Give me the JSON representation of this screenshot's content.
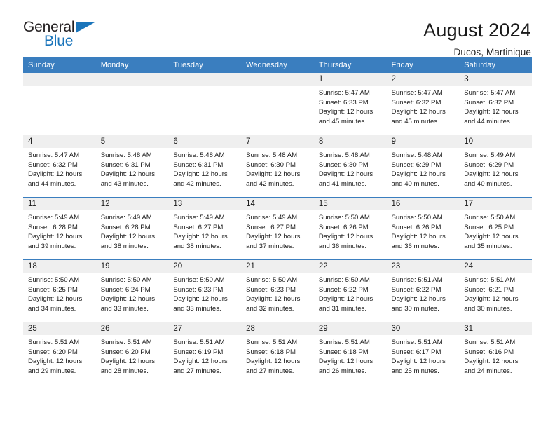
{
  "brand": {
    "name_part1": "General",
    "name_part2": "Blue",
    "triangle_color": "#1b75bb"
  },
  "header": {
    "title": "August 2024",
    "subtitle": "Ducos, Martinique"
  },
  "colors": {
    "header_blue": "#3a7ebf",
    "daynum_band": "#efefef",
    "text": "#1a1a1a"
  },
  "weekday_headers": [
    "Sunday",
    "Monday",
    "Tuesday",
    "Wednesday",
    "Thursday",
    "Friday",
    "Saturday"
  ],
  "weeks": [
    [
      {
        "day": "",
        "lines": []
      },
      {
        "day": "",
        "lines": []
      },
      {
        "day": "",
        "lines": []
      },
      {
        "day": "",
        "lines": []
      },
      {
        "day": "1",
        "lines": [
          "Sunrise: 5:47 AM",
          "Sunset: 6:33 PM",
          "Daylight: 12 hours",
          "and 45 minutes."
        ]
      },
      {
        "day": "2",
        "lines": [
          "Sunrise: 5:47 AM",
          "Sunset: 6:32 PM",
          "Daylight: 12 hours",
          "and 45 minutes."
        ]
      },
      {
        "day": "3",
        "lines": [
          "Sunrise: 5:47 AM",
          "Sunset: 6:32 PM",
          "Daylight: 12 hours",
          "and 44 minutes."
        ]
      }
    ],
    [
      {
        "day": "4",
        "lines": [
          "Sunrise: 5:47 AM",
          "Sunset: 6:32 PM",
          "Daylight: 12 hours",
          "and 44 minutes."
        ]
      },
      {
        "day": "5",
        "lines": [
          "Sunrise: 5:48 AM",
          "Sunset: 6:31 PM",
          "Daylight: 12 hours",
          "and 43 minutes."
        ]
      },
      {
        "day": "6",
        "lines": [
          "Sunrise: 5:48 AM",
          "Sunset: 6:31 PM",
          "Daylight: 12 hours",
          "and 42 minutes."
        ]
      },
      {
        "day": "7",
        "lines": [
          "Sunrise: 5:48 AM",
          "Sunset: 6:30 PM",
          "Daylight: 12 hours",
          "and 42 minutes."
        ]
      },
      {
        "day": "8",
        "lines": [
          "Sunrise: 5:48 AM",
          "Sunset: 6:30 PM",
          "Daylight: 12 hours",
          "and 41 minutes."
        ]
      },
      {
        "day": "9",
        "lines": [
          "Sunrise: 5:48 AM",
          "Sunset: 6:29 PM",
          "Daylight: 12 hours",
          "and 40 minutes."
        ]
      },
      {
        "day": "10",
        "lines": [
          "Sunrise: 5:49 AM",
          "Sunset: 6:29 PM",
          "Daylight: 12 hours",
          "and 40 minutes."
        ]
      }
    ],
    [
      {
        "day": "11",
        "lines": [
          "Sunrise: 5:49 AM",
          "Sunset: 6:28 PM",
          "Daylight: 12 hours",
          "and 39 minutes."
        ]
      },
      {
        "day": "12",
        "lines": [
          "Sunrise: 5:49 AM",
          "Sunset: 6:28 PM",
          "Daylight: 12 hours",
          "and 38 minutes."
        ]
      },
      {
        "day": "13",
        "lines": [
          "Sunrise: 5:49 AM",
          "Sunset: 6:27 PM",
          "Daylight: 12 hours",
          "and 38 minutes."
        ]
      },
      {
        "day": "14",
        "lines": [
          "Sunrise: 5:49 AM",
          "Sunset: 6:27 PM",
          "Daylight: 12 hours",
          "and 37 minutes."
        ]
      },
      {
        "day": "15",
        "lines": [
          "Sunrise: 5:50 AM",
          "Sunset: 6:26 PM",
          "Daylight: 12 hours",
          "and 36 minutes."
        ]
      },
      {
        "day": "16",
        "lines": [
          "Sunrise: 5:50 AM",
          "Sunset: 6:26 PM",
          "Daylight: 12 hours",
          "and 36 minutes."
        ]
      },
      {
        "day": "17",
        "lines": [
          "Sunrise: 5:50 AM",
          "Sunset: 6:25 PM",
          "Daylight: 12 hours",
          "and 35 minutes."
        ]
      }
    ],
    [
      {
        "day": "18",
        "lines": [
          "Sunrise: 5:50 AM",
          "Sunset: 6:25 PM",
          "Daylight: 12 hours",
          "and 34 minutes."
        ]
      },
      {
        "day": "19",
        "lines": [
          "Sunrise: 5:50 AM",
          "Sunset: 6:24 PM",
          "Daylight: 12 hours",
          "and 33 minutes."
        ]
      },
      {
        "day": "20",
        "lines": [
          "Sunrise: 5:50 AM",
          "Sunset: 6:23 PM",
          "Daylight: 12 hours",
          "and 33 minutes."
        ]
      },
      {
        "day": "21",
        "lines": [
          "Sunrise: 5:50 AM",
          "Sunset: 6:23 PM",
          "Daylight: 12 hours",
          "and 32 minutes."
        ]
      },
      {
        "day": "22",
        "lines": [
          "Sunrise: 5:50 AM",
          "Sunset: 6:22 PM",
          "Daylight: 12 hours",
          "and 31 minutes."
        ]
      },
      {
        "day": "23",
        "lines": [
          "Sunrise: 5:51 AM",
          "Sunset: 6:22 PM",
          "Daylight: 12 hours",
          "and 30 minutes."
        ]
      },
      {
        "day": "24",
        "lines": [
          "Sunrise: 5:51 AM",
          "Sunset: 6:21 PM",
          "Daylight: 12 hours",
          "and 30 minutes."
        ]
      }
    ],
    [
      {
        "day": "25",
        "lines": [
          "Sunrise: 5:51 AM",
          "Sunset: 6:20 PM",
          "Daylight: 12 hours",
          "and 29 minutes."
        ]
      },
      {
        "day": "26",
        "lines": [
          "Sunrise: 5:51 AM",
          "Sunset: 6:20 PM",
          "Daylight: 12 hours",
          "and 28 minutes."
        ]
      },
      {
        "day": "27",
        "lines": [
          "Sunrise: 5:51 AM",
          "Sunset: 6:19 PM",
          "Daylight: 12 hours",
          "and 27 minutes."
        ]
      },
      {
        "day": "28",
        "lines": [
          "Sunrise: 5:51 AM",
          "Sunset: 6:18 PM",
          "Daylight: 12 hours",
          "and 27 minutes."
        ]
      },
      {
        "day": "29",
        "lines": [
          "Sunrise: 5:51 AM",
          "Sunset: 6:18 PM",
          "Daylight: 12 hours",
          "and 26 minutes."
        ]
      },
      {
        "day": "30",
        "lines": [
          "Sunrise: 5:51 AM",
          "Sunset: 6:17 PM",
          "Daylight: 12 hours",
          "and 25 minutes."
        ]
      },
      {
        "day": "31",
        "lines": [
          "Sunrise: 5:51 AM",
          "Sunset: 6:16 PM",
          "Daylight: 12 hours",
          "and 24 minutes."
        ]
      }
    ]
  ]
}
